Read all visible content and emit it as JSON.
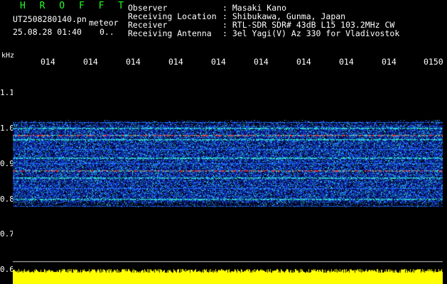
{
  "header": {
    "title": "H R O F F T",
    "file_name": "UT2508280140.pn",
    "software": "meteor",
    "datetime": "25.08.28 01:40",
    "count": "0..",
    "info": [
      {
        "label": "Observer",
        "value": ": Masaki Kano"
      },
      {
        "label": "Receiving Location",
        "value": ": Shibukawa, Gunma, Japan"
      },
      {
        "label": "Receiver",
        "value": ": RTL-SDR SDR# 43dB L15 103.2MHz CW"
      },
      {
        "label": "Receiving Antenna",
        "value": ": 3el Yagi(V) Az 330 for Vladivostok"
      }
    ]
  },
  "axis": {
    "unit": "kHz",
    "time_ticks": [
      "014",
      "014",
      "014",
      "014",
      "014",
      "014",
      "014",
      "014",
      "014",
      "0150"
    ],
    "freq_labels": [
      "1.1",
      "1.0",
      "0.9",
      "0.8",
      "0.7",
      "0.6"
    ]
  },
  "colors": {
    "background": "#000000",
    "title": "#22ff22",
    "noise_low": "#0a1a9a",
    "noise_mid": "#1e6cff",
    "noise_high": "#2fd8d0",
    "signal": "#ff2a2a",
    "level_bar": "#ffff00"
  }
}
